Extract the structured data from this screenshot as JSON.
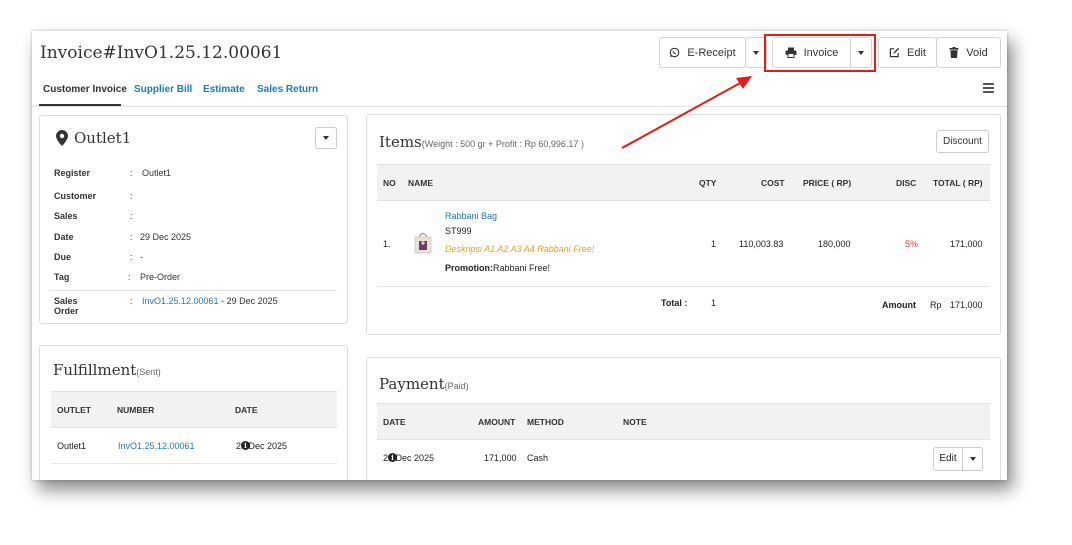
{
  "header": {
    "title": "Invoice#InvO1.25.12.00061",
    "ereceipt_label": "E-Receipt",
    "invoice_label": "Invoice",
    "edit_label": "Edit",
    "void_label": "Void"
  },
  "tabs": [
    {
      "label": "Customer Invoice"
    },
    {
      "label": "Supplier Bill"
    },
    {
      "label": "Estimate"
    },
    {
      "label": "Sales Return"
    }
  ],
  "outlet": {
    "name": "Outlet1",
    "rows": [
      {
        "label": "Register",
        "value": "Outlet1"
      },
      {
        "label": "Customer",
        "value": ""
      },
      {
        "label": "Sales",
        "value": ""
      },
      {
        "label": "Date",
        "value": "29 Dec 2025"
      },
      {
        "label": "Due",
        "value": "-"
      },
      {
        "label": "Tag",
        "value": "Pre-Order"
      }
    ],
    "sales_order_label": "Sales Order",
    "sales_order_number": "InvO1.25.12.00061",
    "sales_order_date": "- 29 Dec 2025"
  },
  "fulfillment": {
    "title": "Fulfillment",
    "status": "(Sent)",
    "headers": [
      "OUTLET",
      "NUMBER",
      "DATE"
    ],
    "row": {
      "outlet": "Outlet1",
      "number": "InvO1.25.12.00061",
      "date": "29 Dec 2025"
    }
  },
  "items": {
    "title": "Items",
    "subtitle": "(Weight : 500 gr + Profit : Rp 60,996.17 )",
    "discount_label": "Discount",
    "headers": [
      "NO",
      "NAME",
      "QTY",
      "COST",
      "PRICE ( RP)",
      "DISC",
      "TOTAL ( RP)"
    ],
    "row": {
      "no": "1.",
      "name": "Rabbani Bag",
      "sku": "ST999",
      "description": "Deskripsi A1 A2 A3 A4 Rabbani Free!",
      "promotion_label": "Promotion:",
      "promotion_value": "Rabbani Free!",
      "qty": "1",
      "cost": "110,003.83",
      "price": "180,000",
      "disc": "5%",
      "total": "171,000"
    },
    "total_label": "Total :",
    "total_qty": "1",
    "amount_label": "Amount",
    "amount_currency": "Rp",
    "amount_value": "171,000"
  },
  "payment": {
    "title": "Payment",
    "status": "(Paid)",
    "headers": [
      "DATE",
      "AMOUNT",
      "METHOD",
      "NOTE"
    ],
    "row": {
      "date": "29 Dec 2025",
      "amount": "171,000",
      "method": "Cash",
      "note": ""
    },
    "edit_label": "Edit"
  },
  "colors": {
    "link": "#1f7ab8",
    "highlight": "#e21b1b",
    "description": "#e8a020",
    "discount": "#e53935"
  }
}
